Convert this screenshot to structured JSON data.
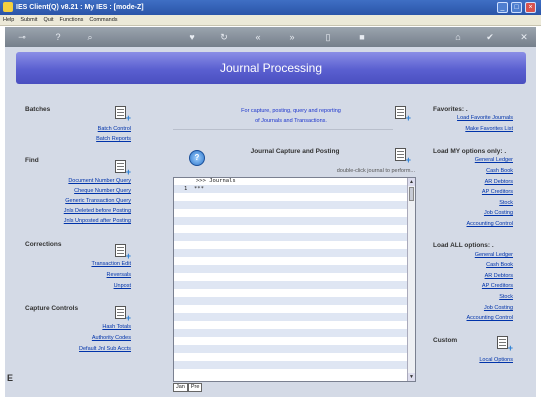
{
  "window": {
    "title": "IES Client(Q) v8.21 : My IES :      [mode-Z]"
  },
  "menu": [
    "Help",
    "Submit",
    "Quit",
    "Functions",
    "Commands"
  ],
  "toolbar": {
    "icons": [
      "key-icon",
      "help-icon",
      "search-icon",
      "heart-icon",
      "refresh-icon",
      "back-icon",
      "forward-icon",
      "file-icon",
      "stop-icon",
      "home-icon",
      "check-icon",
      "close-icon"
    ]
  },
  "header": {
    "title": "Journal Processing"
  },
  "batches": {
    "title": "Batches",
    "links": [
      "Batch Control",
      "Batch Reports"
    ]
  },
  "find": {
    "title": "Find",
    "links": [
      "Document Number Query",
      "Cheque Number Query",
      "Generic Transaction Query",
      "Jnls Deleted before Posting",
      "Jnls Unposted after Posting"
    ]
  },
  "corrections": {
    "title": "Corrections",
    "links": [
      "Transaction Edit",
      "Reversals",
      "Unpost"
    ]
  },
  "capture_controls": {
    "title": "Capture Controls",
    "links": [
      "Hash Totals",
      "Authority Codes",
      "Default Jnl Sub Accts"
    ]
  },
  "info": {
    "line1": "For capture, posting, query and reporting",
    "line2": "of Journals and Transactions."
  },
  "capture": {
    "title": "Journal Capture and Posting",
    "hint": "double-click journal to perform..."
  },
  "grid": {
    "header": ">>> Journals",
    "rows": [
      {
        "n": "1",
        "v": "***"
      }
    ]
  },
  "tabs": [
    "Jan",
    "Pre"
  ],
  "favorites": {
    "title": "Favorites: .",
    "links": [
      "Load Favorite Journals",
      "Make Favorites List"
    ]
  },
  "load_my": {
    "title": "Load MY options only: .",
    "links": [
      "General Ledger",
      "Cash Book",
      "AR Debtors",
      "AP Creditors",
      "Stock",
      "Job Costing",
      "Accounting Control"
    ]
  },
  "load_all": {
    "title": "Load ALL options: .",
    "links": [
      "General Ledger",
      "Cash Book",
      "AR Debtors",
      "AP Creditors",
      "Stock",
      "Job Costing",
      "Accounting Control"
    ]
  },
  "custom": {
    "title": "Custom",
    "links": [
      "Local Options"
    ]
  },
  "side_letter": "E"
}
